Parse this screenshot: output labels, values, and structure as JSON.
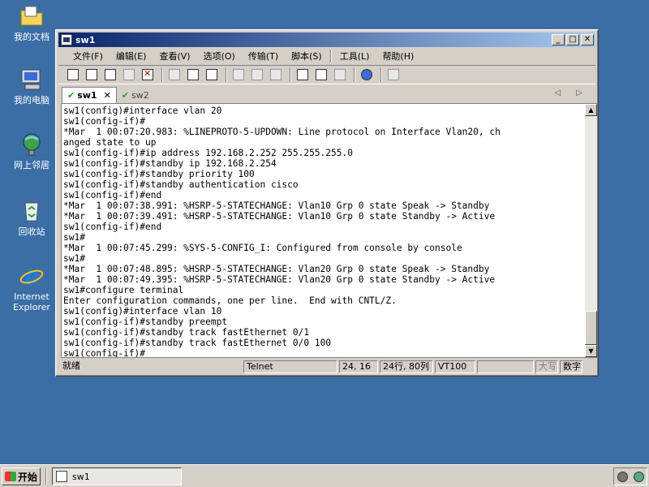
{
  "desktop": {
    "icons": [
      {
        "label": "我的文档"
      },
      {
        "label": "我的电脑"
      },
      {
        "label": "网上邻居"
      },
      {
        "label": "回收站"
      },
      {
        "label": "Internet\nExplorer"
      }
    ]
  },
  "window": {
    "title": "sw1",
    "buttons": {
      "minimize": "_",
      "maximize": "□",
      "close": "✕"
    }
  },
  "menu": [
    "文件(F)",
    "编辑(E)",
    "查看(V)",
    "选项(O)",
    "传输(T)",
    "脚本(S)",
    "工具(L)",
    "帮助(H)"
  ],
  "tabs": [
    {
      "label": "sw1",
      "active": true,
      "close": "✕"
    },
    {
      "label": "sw2",
      "active": false
    }
  ],
  "tab_nav": "◁ ▷",
  "terminal": {
    "lines": [
      "sw1(config)#interface vlan 20",
      "sw1(config-if)#",
      "*Mar  1 00:07:20.983: %LINEPROTO-5-UPDOWN: Line protocol on Interface Vlan20, ch",
      "anged state to up",
      "sw1(config-if)#ip address 192.168.2.252 255.255.255.0",
      "sw1(config-if)#standby ip 192.168.2.254",
      "sw1(config-if)#standby priority 100",
      "sw1(config-if)#standby authentication cisco",
      "sw1(config-if)#end",
      "*Mar  1 00:07:38.991: %HSRP-5-STATECHANGE: Vlan10 Grp 0 state Speak -> Standby",
      "*Mar  1 00:07:39.491: %HSRP-5-STATECHANGE: Vlan10 Grp 0 state Standby -> Active",
      "sw1(config-if)#end",
      "sw1#",
      "*Mar  1 00:07:45.299: %SYS-5-CONFIG_I: Configured from console by console",
      "sw1#",
      "*Mar  1 00:07:48.895: %HSRP-5-STATECHANGE: Vlan20 Grp 0 state Speak -> Standby",
      "*Mar  1 00:07:49.395: %HSRP-5-STATECHANGE: Vlan20 Grp 0 state Standby -> Active",
      "sw1#configure terminal",
      "Enter configuration commands, one per line.  End with CNTL/Z.",
      "sw1(config)#interface vlan 10",
      "sw1(config-if)#standby preempt",
      "sw1(config-if)#standby track fastEthernet 0/1",
      "sw1(config-if)#standby track fastEthernet 0/0 100",
      "sw1(config-if)#"
    ]
  },
  "statusbar": {
    "ready": "就绪",
    "protocol": "Telnet",
    "cursor": "24, 16",
    "size": "24行, 80列",
    "emulation": "VT100",
    "caps": "大写",
    "num": "数字"
  },
  "taskbar": {
    "start": "开始",
    "task": "sw1"
  }
}
